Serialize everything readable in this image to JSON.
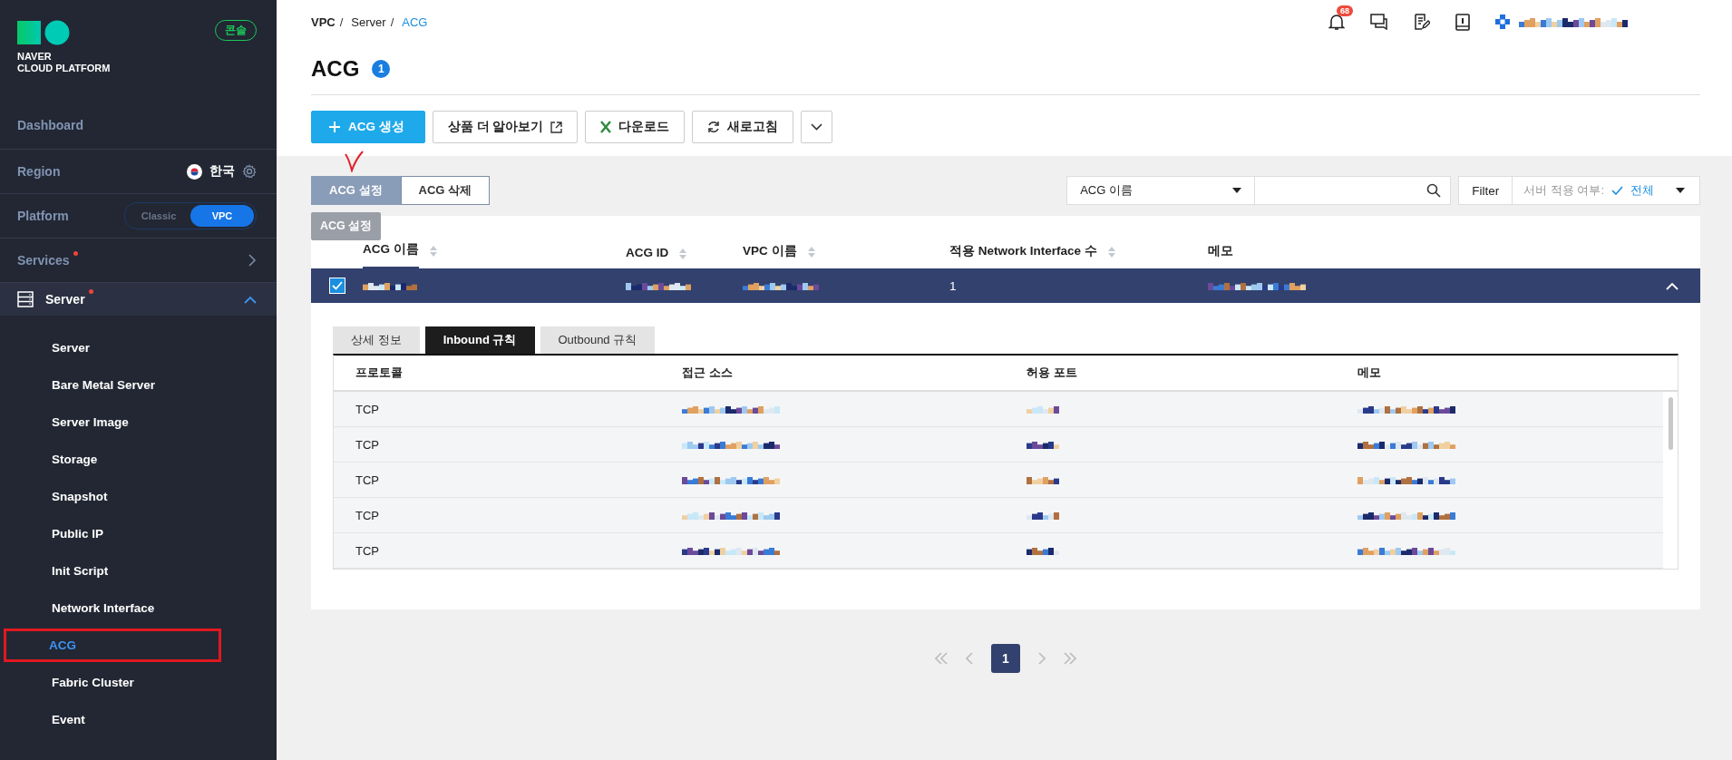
{
  "sidebar": {
    "logo_lines": [
      "NAVER",
      "CLOUD PLATFORM"
    ],
    "console_badge": "콘솔",
    "dashboard": "Dashboard",
    "region": {
      "label": "Region",
      "value": "한국"
    },
    "platform": {
      "label": "Platform",
      "options": [
        {
          "label": "Classic",
          "selected": false
        },
        {
          "label": "VPC",
          "selected": true
        }
      ]
    },
    "services": {
      "label": "Services",
      "new": true
    },
    "section": {
      "label": "Server",
      "new": true,
      "expanded": true,
      "items": [
        {
          "label": "Server",
          "selected": false,
          "highlighted": false
        },
        {
          "label": "Bare Metal Server",
          "selected": false,
          "highlighted": false
        },
        {
          "label": "Server Image",
          "selected": false,
          "highlighted": false
        },
        {
          "label": "Storage",
          "selected": false,
          "highlighted": false
        },
        {
          "label": "Snapshot",
          "selected": false,
          "highlighted": false
        },
        {
          "label": "Public IP",
          "selected": false,
          "highlighted": false
        },
        {
          "label": "Init Script",
          "selected": false,
          "highlighted": false
        },
        {
          "label": "Network Interface",
          "selected": false,
          "highlighted": false
        },
        {
          "label": "ACG",
          "selected": true,
          "highlighted": true
        },
        {
          "label": "Fabric Cluster",
          "selected": false,
          "highlighted": false
        },
        {
          "label": "Event",
          "selected": false,
          "highlighted": false
        }
      ]
    }
  },
  "breadcrumb_separator": "/",
  "breadcrumb": [
    {
      "label": "VPC",
      "current": false
    },
    {
      "label": "Server",
      "current": false
    },
    {
      "label": "ACG",
      "current": true
    }
  ],
  "header": {
    "notification_count": "68"
  },
  "title": "ACG",
  "title_count": "1",
  "toolbar": [
    {
      "kind": "primary",
      "label": "ACG 생성"
    },
    {
      "kind": "external",
      "label": "상품 더 알아보기"
    },
    {
      "kind": "excel",
      "label": "다운로드"
    },
    {
      "kind": "refresh",
      "label": "새로고침"
    },
    {
      "kind": "more"
    }
  ],
  "actions": [
    {
      "label": "ACG 설정",
      "selected": true
    },
    {
      "label": "ACG 삭제",
      "selected": false
    }
  ],
  "tooltip": "ACG 설정",
  "search": {
    "field": "ACG 이름",
    "filter_button": "Filter",
    "filter_name": "서버 적용 여부:",
    "filter_value": "전체"
  },
  "table": {
    "columns": [
      {
        "label": "ACG 이름",
        "sorted": true
      },
      {
        "label": "ACG ID",
        "sorted": false
      },
      {
        "label": "VPC 이름",
        "sorted": false
      },
      {
        "label": "적용 Network Interface 수",
        "sorted": false
      },
      {
        "label": "메모",
        "sorted": false
      }
    ],
    "rows": [
      {
        "selected": true,
        "expanded": true,
        "cells": [
          {
            "kind": "redacted"
          },
          {
            "kind": "redacted"
          },
          {
            "kind": "redacted"
          },
          {
            "kind": "text",
            "text": "1"
          },
          {
            "kind": "redacted"
          }
        ]
      }
    ]
  },
  "detail": {
    "tabs": [
      {
        "label": "상세 정보",
        "selected": false
      },
      {
        "label": "Inbound 규칙",
        "selected": true
      },
      {
        "label": "Outbound 규칙",
        "selected": false
      }
    ],
    "columns": [
      "프로토콜",
      "접근 소스",
      "허용 포트",
      "메모"
    ],
    "rows": [
      {
        "cells": [
          {
            "kind": "text",
            "text": "TCP"
          },
          {
            "kind": "redacted"
          },
          {
            "kind": "redacted"
          },
          {
            "kind": "redacted"
          }
        ]
      },
      {
        "cells": [
          {
            "kind": "text",
            "text": "TCP"
          },
          {
            "kind": "redacted"
          },
          {
            "kind": "redacted"
          },
          {
            "kind": "redacted"
          }
        ]
      },
      {
        "cells": [
          {
            "kind": "text",
            "text": "TCP"
          },
          {
            "kind": "redacted"
          },
          {
            "kind": "redacted"
          },
          {
            "kind": "redacted"
          }
        ]
      },
      {
        "cells": [
          {
            "kind": "text",
            "text": "TCP"
          },
          {
            "kind": "redacted"
          },
          {
            "kind": "redacted"
          },
          {
            "kind": "redacted"
          }
        ]
      },
      {
        "cells": [
          {
            "kind": "text",
            "text": "TCP"
          },
          {
            "kind": "redacted"
          },
          {
            "kind": "redacted"
          },
          {
            "kind": "redacted"
          }
        ]
      }
    ]
  },
  "pagination": {
    "pages": [
      {
        "label": "1",
        "selected": true
      }
    ]
  }
}
